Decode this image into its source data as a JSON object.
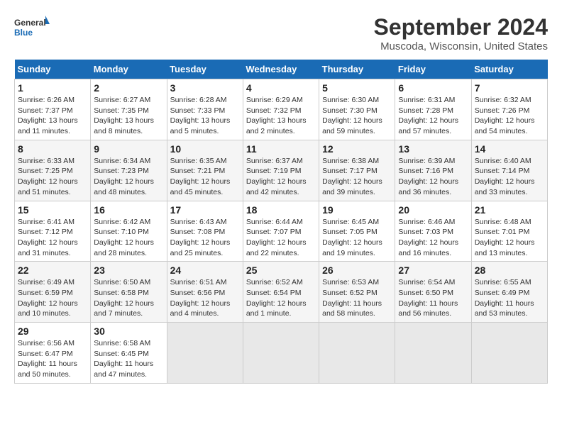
{
  "logo": {
    "text_general": "General",
    "text_blue": "Blue"
  },
  "header": {
    "month": "September 2024",
    "location": "Muscoda, Wisconsin, United States"
  },
  "days_of_week": [
    "Sunday",
    "Monday",
    "Tuesday",
    "Wednesday",
    "Thursday",
    "Friday",
    "Saturday"
  ],
  "weeks": [
    [
      {
        "day": "1",
        "sunrise": "6:26 AM",
        "sunset": "7:37 PM",
        "daylight": "13 hours and 11 minutes."
      },
      {
        "day": "2",
        "sunrise": "6:27 AM",
        "sunset": "7:35 PM",
        "daylight": "13 hours and 8 minutes."
      },
      {
        "day": "3",
        "sunrise": "6:28 AM",
        "sunset": "7:33 PM",
        "daylight": "13 hours and 5 minutes."
      },
      {
        "day": "4",
        "sunrise": "6:29 AM",
        "sunset": "7:32 PM",
        "daylight": "13 hours and 2 minutes."
      },
      {
        "day": "5",
        "sunrise": "6:30 AM",
        "sunset": "7:30 PM",
        "daylight": "12 hours and 59 minutes."
      },
      {
        "day": "6",
        "sunrise": "6:31 AM",
        "sunset": "7:28 PM",
        "daylight": "12 hours and 57 minutes."
      },
      {
        "day": "7",
        "sunrise": "6:32 AM",
        "sunset": "7:26 PM",
        "daylight": "12 hours and 54 minutes."
      }
    ],
    [
      {
        "day": "8",
        "sunrise": "6:33 AM",
        "sunset": "7:25 PM",
        "daylight": "12 hours and 51 minutes."
      },
      {
        "day": "9",
        "sunrise": "6:34 AM",
        "sunset": "7:23 PM",
        "daylight": "12 hours and 48 minutes."
      },
      {
        "day": "10",
        "sunrise": "6:35 AM",
        "sunset": "7:21 PM",
        "daylight": "12 hours and 45 minutes."
      },
      {
        "day": "11",
        "sunrise": "6:37 AM",
        "sunset": "7:19 PM",
        "daylight": "12 hours and 42 minutes."
      },
      {
        "day": "12",
        "sunrise": "6:38 AM",
        "sunset": "7:17 PM",
        "daylight": "12 hours and 39 minutes."
      },
      {
        "day": "13",
        "sunrise": "6:39 AM",
        "sunset": "7:16 PM",
        "daylight": "12 hours and 36 minutes."
      },
      {
        "day": "14",
        "sunrise": "6:40 AM",
        "sunset": "7:14 PM",
        "daylight": "12 hours and 33 minutes."
      }
    ],
    [
      {
        "day": "15",
        "sunrise": "6:41 AM",
        "sunset": "7:12 PM",
        "daylight": "12 hours and 31 minutes."
      },
      {
        "day": "16",
        "sunrise": "6:42 AM",
        "sunset": "7:10 PM",
        "daylight": "12 hours and 28 minutes."
      },
      {
        "day": "17",
        "sunrise": "6:43 AM",
        "sunset": "7:08 PM",
        "daylight": "12 hours and 25 minutes."
      },
      {
        "day": "18",
        "sunrise": "6:44 AM",
        "sunset": "7:07 PM",
        "daylight": "12 hours and 22 minutes."
      },
      {
        "day": "19",
        "sunrise": "6:45 AM",
        "sunset": "7:05 PM",
        "daylight": "12 hours and 19 minutes."
      },
      {
        "day": "20",
        "sunrise": "6:46 AM",
        "sunset": "7:03 PM",
        "daylight": "12 hours and 16 minutes."
      },
      {
        "day": "21",
        "sunrise": "6:48 AM",
        "sunset": "7:01 PM",
        "daylight": "12 hours and 13 minutes."
      }
    ],
    [
      {
        "day": "22",
        "sunrise": "6:49 AM",
        "sunset": "6:59 PM",
        "daylight": "12 hours and 10 minutes."
      },
      {
        "day": "23",
        "sunrise": "6:50 AM",
        "sunset": "6:58 PM",
        "daylight": "12 hours and 7 minutes."
      },
      {
        "day": "24",
        "sunrise": "6:51 AM",
        "sunset": "6:56 PM",
        "daylight": "12 hours and 4 minutes."
      },
      {
        "day": "25",
        "sunrise": "6:52 AM",
        "sunset": "6:54 PM",
        "daylight": "12 hours and 1 minute."
      },
      {
        "day": "26",
        "sunrise": "6:53 AM",
        "sunset": "6:52 PM",
        "daylight": "11 hours and 58 minutes."
      },
      {
        "day": "27",
        "sunrise": "6:54 AM",
        "sunset": "6:50 PM",
        "daylight": "11 hours and 56 minutes."
      },
      {
        "day": "28",
        "sunrise": "6:55 AM",
        "sunset": "6:49 PM",
        "daylight": "11 hours and 53 minutes."
      }
    ],
    [
      {
        "day": "29",
        "sunrise": "6:56 AM",
        "sunset": "6:47 PM",
        "daylight": "11 hours and 50 minutes."
      },
      {
        "day": "30",
        "sunrise": "6:58 AM",
        "sunset": "6:45 PM",
        "daylight": "11 hours and 47 minutes."
      },
      null,
      null,
      null,
      null,
      null
    ]
  ]
}
